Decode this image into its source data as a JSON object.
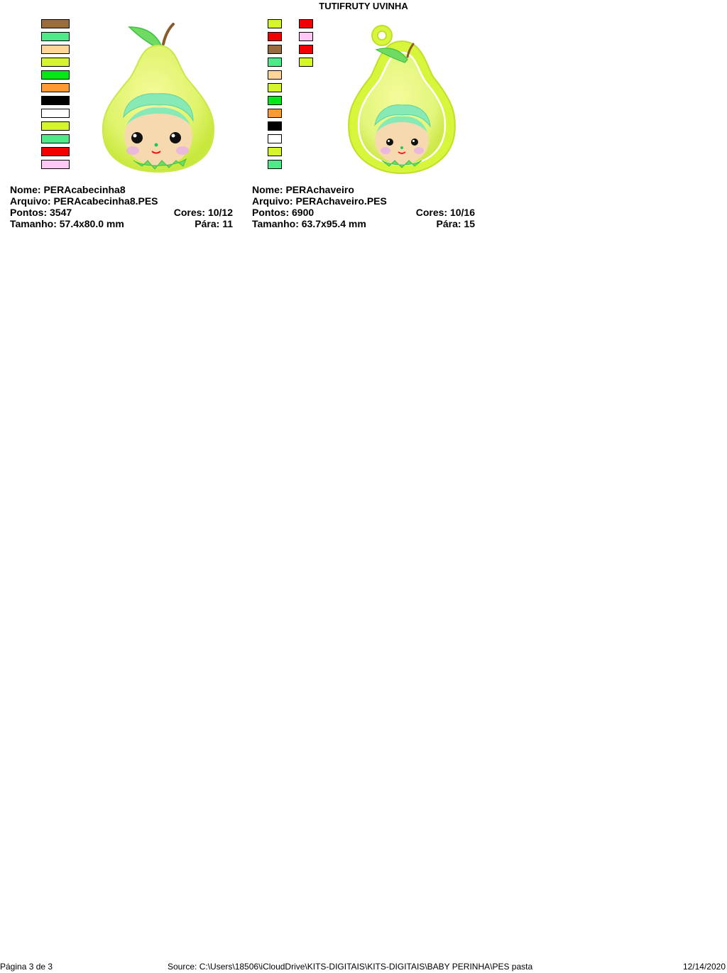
{
  "title": "TUTIFRUTY UVINHA",
  "designs": [
    {
      "name": "Nome: PERAcabecinha8",
      "file": "Arquivo: PERAcabecinha8.PES",
      "stitches": "Pontos: 3547",
      "colors": "Cores: 10/12",
      "size": "Tamanho: 57.4x80.0 mm",
      "stops": "Pára: 11",
      "swatches": [
        "#9A6B3E",
        "#4EEA88",
        "#FFD59A",
        "#D7F52C",
        "#00E81A",
        "#FF9933",
        "#000000",
        "#FFFFFF",
        "#D7F52C",
        "#4EEA88",
        "#F20000",
        "#FFC8F5"
      ]
    },
    {
      "name": "Nome: PERAchaveiro",
      "file": "Arquivo: PERAchaveiro.PES",
      "stitches": "Pontos: 6900",
      "colors": "Cores: 10/16",
      "size": "Tamanho: 63.7x95.4 mm",
      "stops": "Pára: 15",
      "swatches_col1": [
        "#D7F52C",
        "#F20000",
        "#9A6B3E",
        "#4EEA88",
        "#FFD59A",
        "#D7F52C",
        "#00E81A",
        "#FF9933",
        "#000000",
        "#FFFFFF",
        "#D7F52C",
        "#4EEA88"
      ],
      "swatches_col2": [
        "#F20000",
        "#FFC8F5",
        "#F20000",
        "#D7F52C"
      ]
    }
  ],
  "footer": {
    "page": "Página 3 de 3",
    "source": "Source: C:\\Users\\18506\\iCloudDrive\\KITS-DIGITAIS\\KITS-DIGITAIS\\BABY PERINHA\\PES pasta",
    "date": "12/14/2020"
  }
}
